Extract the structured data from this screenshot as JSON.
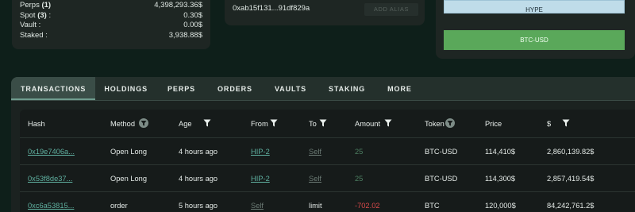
{
  "balances": [
    {
      "label": "Perps",
      "count": "(1)",
      "value": "4,398,293.36$"
    },
    {
      "label": "Spot",
      "count": "(3)",
      "value": "0.30$"
    },
    {
      "label": "Vault",
      "count": "",
      "value": "0.00$"
    },
    {
      "label": "Staked",
      "count": "",
      "value": "3,938.88$"
    }
  ],
  "address": {
    "text": "0xab15f131...91df829a",
    "alias_button": "ADD ALIAS"
  },
  "right_card": {
    "hype_label": "HYPE",
    "btc_label": "BTC-USD"
  },
  "tabs": [
    "TRANSACTIONS",
    "HOLDINGS",
    "PERPS",
    "ORDERS",
    "VAULTS",
    "STAKING",
    "MORE"
  ],
  "table": {
    "headers": [
      "Hash",
      "Method",
      "Age",
      "From",
      "To",
      "Amount",
      "Token",
      "Price",
      "$"
    ],
    "rows": [
      {
        "hash": "0x19e7406a...",
        "method": "Open Long",
        "age": "4 hours ago",
        "from": "HIP-2",
        "to": "Self",
        "amount": "25",
        "token": "BTC-USD",
        "price": "114,410$",
        "usd": "2,860,139.82$"
      },
      {
        "hash": "0x53f8de37...",
        "method": "Open Long",
        "age": "4 hours ago",
        "from": "HIP-2",
        "to": "Self",
        "amount": "25",
        "token": "BTC-USD",
        "price": "114,300$",
        "usd": "2,857,419.54$"
      },
      {
        "hash": "0xc6a53815...",
        "method": "order",
        "age": "5 hours ago",
        "from": "Self",
        "to": "limit",
        "amount": "-702.02",
        "token": "BTC",
        "price": "120,000$",
        "usd": "84,242,761.2$"
      }
    ]
  },
  "colors": {
    "accent_green": "#5aa85a",
    "link": "#5fb0a0",
    "negative": "#d84a4a",
    "positive": "#4f9e54"
  }
}
